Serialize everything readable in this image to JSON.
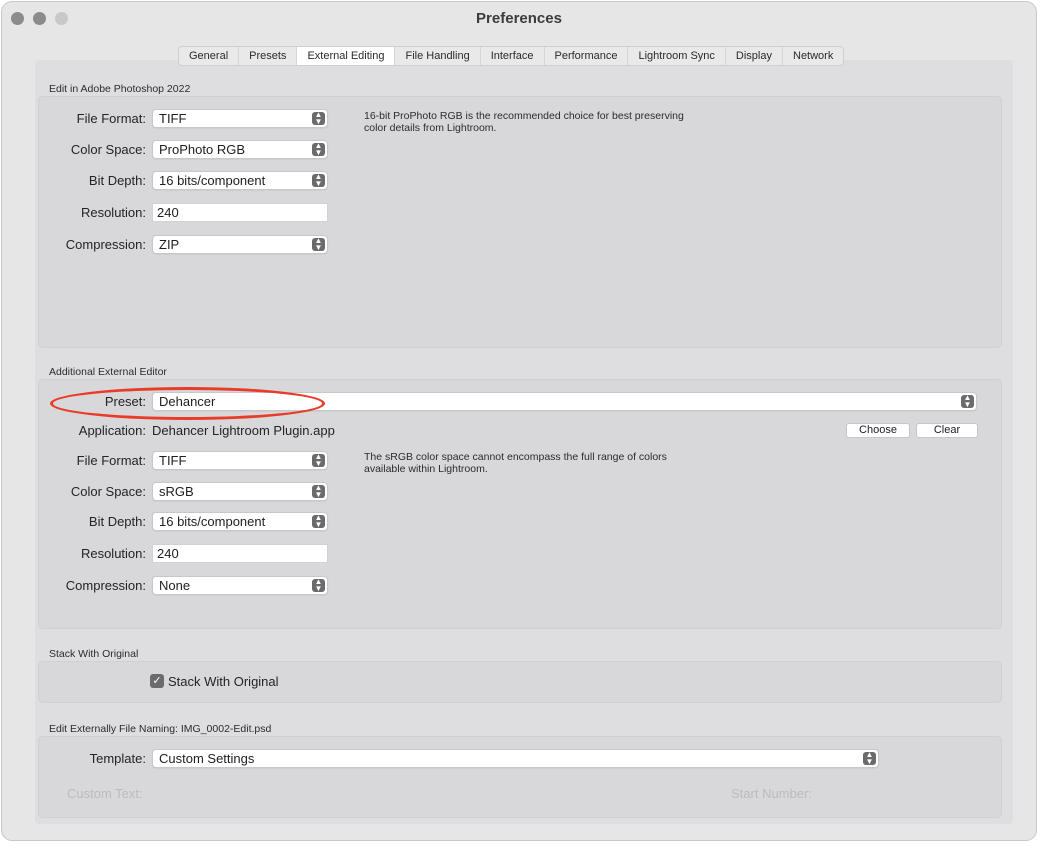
{
  "window": {
    "title": "Preferences",
    "tabs": [
      {
        "label": "General"
      },
      {
        "label": "Presets"
      },
      {
        "label": "External Editing",
        "active": true
      },
      {
        "label": "File Handling"
      },
      {
        "label": "Interface"
      },
      {
        "label": "Performance"
      },
      {
        "label": "Lightroom Sync"
      },
      {
        "label": "Display"
      },
      {
        "label": "Network"
      }
    ]
  },
  "photoshop": {
    "section_title": "Edit in Adobe Photoshop 2022",
    "file_format_label": "File Format:",
    "file_format_value": "TIFF",
    "color_space_label": "Color Space:",
    "color_space_value": "ProPhoto RGB",
    "bit_depth_label": "Bit Depth:",
    "bit_depth_value": "16 bits/component",
    "resolution_label": "Resolution:",
    "resolution_value": "240",
    "compression_label": "Compression:",
    "compression_value": "ZIP",
    "hint_line1": "16-bit ProPhoto RGB is the recommended choice for best preserving",
    "hint_line2": "color details from Lightroom."
  },
  "additional": {
    "section_title": "Additional External Editor",
    "preset_label": "Preset:",
    "preset_value": "Dehancer",
    "application_label": "Application:",
    "application_value": "Dehancer Lightroom Plugin.app",
    "choose_label": "Choose",
    "clear_label": "Clear",
    "file_format_label": "File Format:",
    "file_format_value": "TIFF",
    "color_space_label": "Color Space:",
    "color_space_value": "sRGB",
    "bit_depth_label": "Bit Depth:",
    "bit_depth_value": "16 bits/component",
    "resolution_label": "Resolution:",
    "resolution_value": "240",
    "compression_label": "Compression:",
    "compression_value": "None",
    "hint_line1": "The sRGB color space cannot encompass the full range of colors",
    "hint_line2": "available within Lightroom."
  },
  "stack": {
    "section_title": "Stack With Original",
    "checkbox_label": "Stack With Original",
    "checked": true
  },
  "naming": {
    "section_title": "Edit Externally File Naming:",
    "example": "IMG_0002-Edit.psd",
    "template_label": "Template:",
    "template_value": "Custom Settings",
    "custom_text_label": "Custom Text:",
    "start_number_label": "Start Number:"
  },
  "icons": {
    "popup_stepper": "up-down-chevron-icon",
    "checkmark": "checkmark-icon"
  },
  "colors": {
    "annotation": "#e83c2a",
    "window_bg": "#e7e6e7",
    "group_bg": "#d8d7d9"
  }
}
